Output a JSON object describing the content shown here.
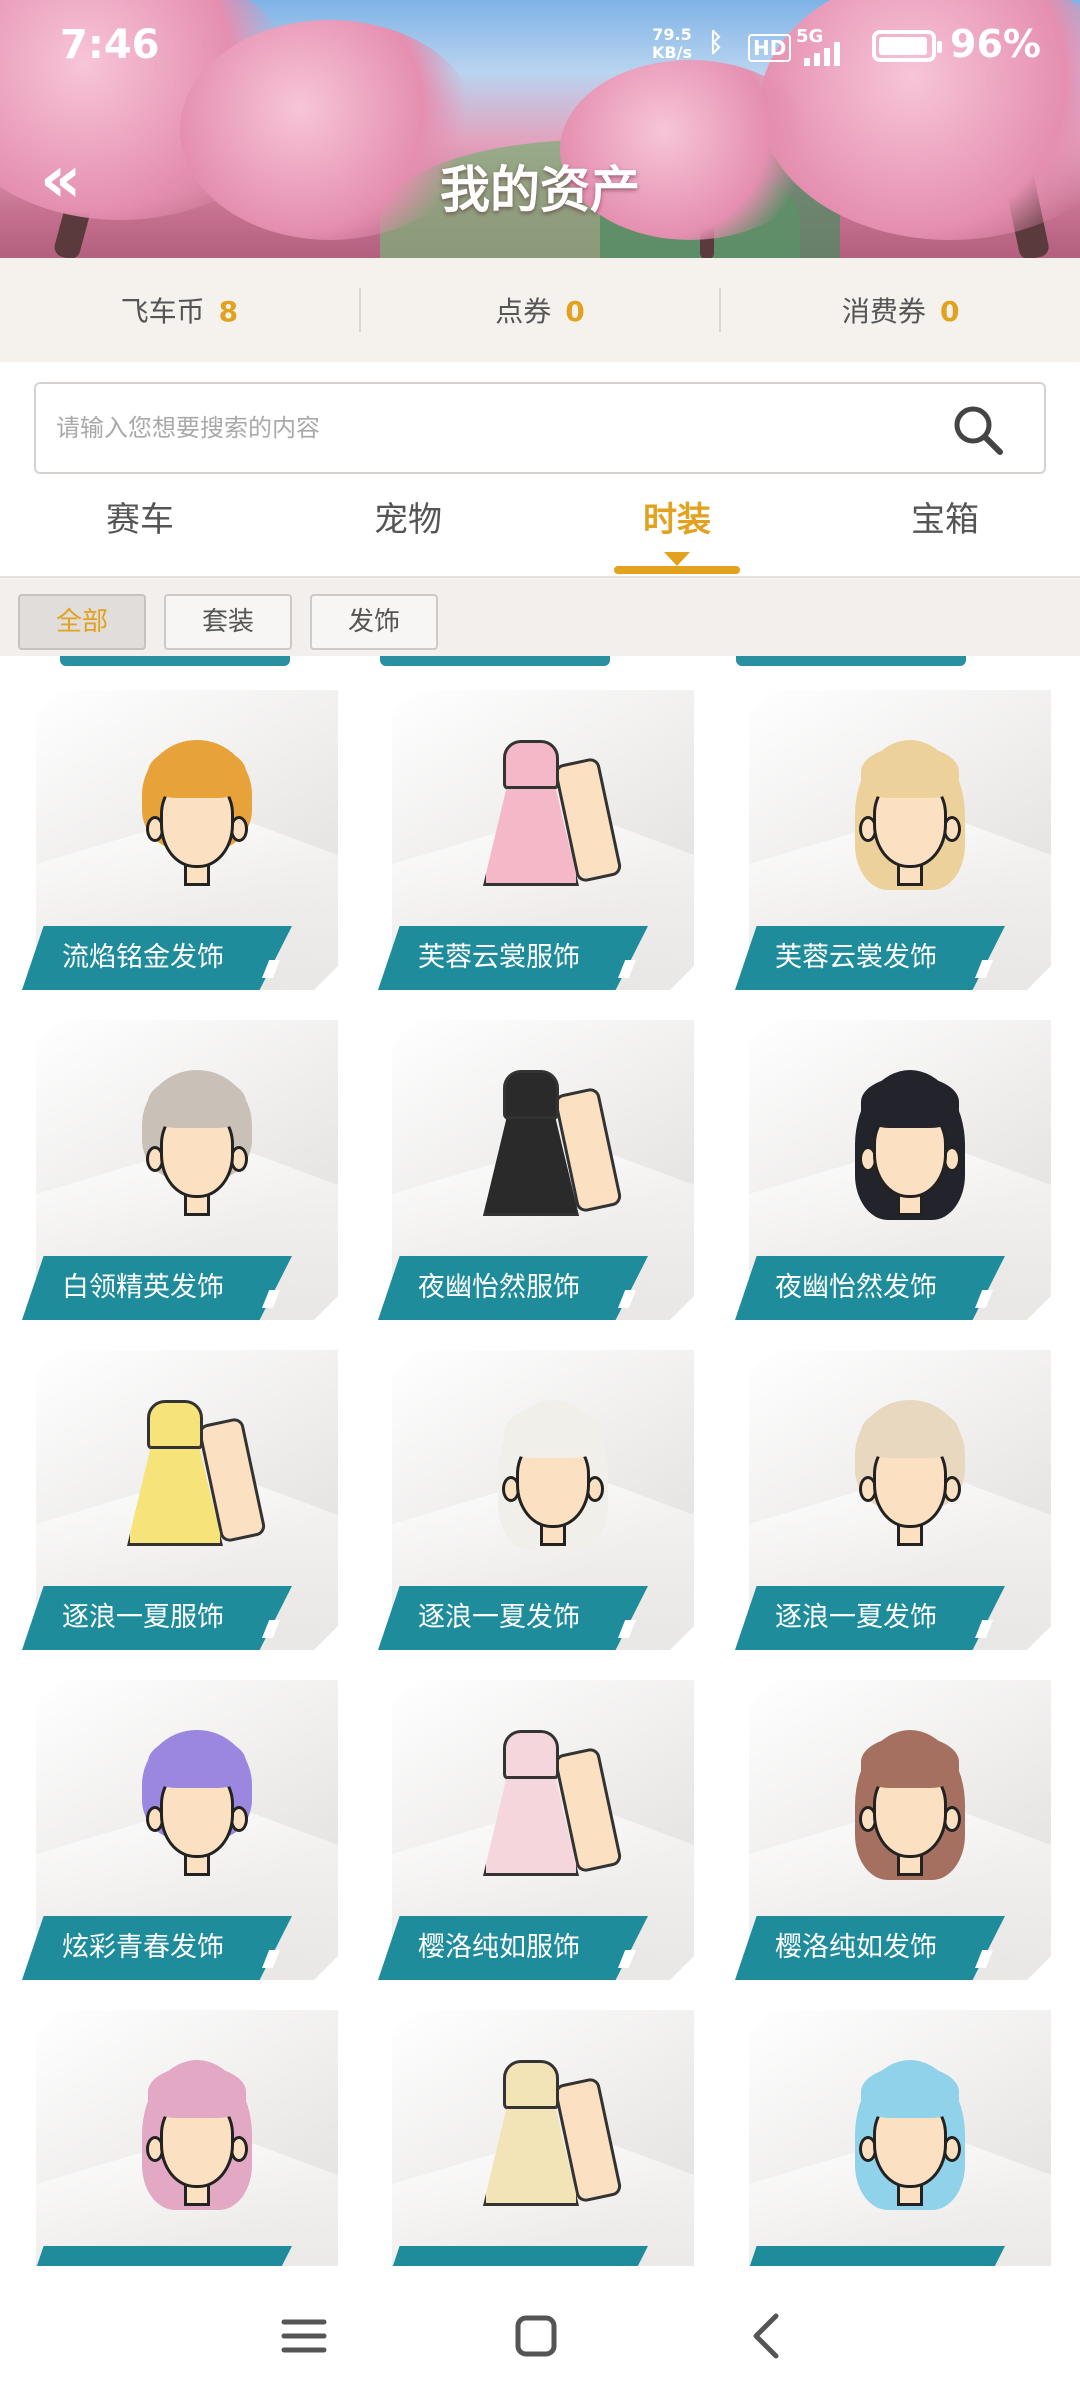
{
  "status_bar": {
    "time": "7:46",
    "net_speed_value": "79.5",
    "net_speed_unit": "KB/s",
    "hd": "HD",
    "signal": "5G",
    "battery_pct": 96,
    "battery_text": "96%"
  },
  "header": {
    "title": "我的资产",
    "back_icon": "double-chevron-left-icon"
  },
  "currency": [
    {
      "label": "飞车币",
      "value": "8"
    },
    {
      "label": "点券",
      "value": "0"
    },
    {
      "label": "消费券",
      "value": "0"
    }
  ],
  "search": {
    "placeholder": "请输入您想要搜索的内容",
    "icon": "search-icon"
  },
  "tabs": [
    {
      "label": "赛车",
      "active": false
    },
    {
      "label": "宠物",
      "active": false
    },
    {
      "label": "时装",
      "active": true
    },
    {
      "label": "宝箱",
      "active": false
    }
  ],
  "filters": [
    {
      "label": "全部",
      "active": true
    },
    {
      "label": "套装",
      "active": false
    },
    {
      "label": "发饰",
      "active": false
    }
  ],
  "items": [
    {
      "name": "流焰铭金发饰",
      "kind": "hair",
      "hair_color": "#e8a23a"
    },
    {
      "name": "芙蓉云裳服饰",
      "kind": "dress",
      "hair_color": "#f4b8c8"
    },
    {
      "name": "芙蓉云裳发饰",
      "kind": "hair-long",
      "hair_color": "#ecd19a"
    },
    {
      "name": "白领精英发饰",
      "kind": "hair",
      "hair_color": "#c9c1b8"
    },
    {
      "name": "夜幽怡然服饰",
      "kind": "dress",
      "hair_color": "#2a2a2a"
    },
    {
      "name": "夜幽怡然发饰",
      "kind": "hair-long",
      "hair_color": "#23232b"
    },
    {
      "name": "逐浪一夏服饰",
      "kind": "dress",
      "hair_color": "#f6e37a"
    },
    {
      "name": "逐浪一夏发饰",
      "kind": "hair-long",
      "hair_color": "#f1efe9"
    },
    {
      "name": "逐浪一夏发饰",
      "kind": "hair",
      "hair_color": "#e9d8c0"
    },
    {
      "name": "炫彩青春发饰",
      "kind": "hair",
      "hair_color": "#9b86e0"
    },
    {
      "name": "樱洛纯如服饰",
      "kind": "dress",
      "hair_color": "#f5d6dc"
    },
    {
      "name": "樱洛纯如发饰",
      "kind": "hair-long",
      "hair_color": "#a5705f"
    },
    {
      "name": "",
      "kind": "hair-long",
      "hair_color": "#e3a8c4"
    },
    {
      "name": "",
      "kind": "dress",
      "hair_color": "#f2e4b6"
    },
    {
      "name": "",
      "kind": "hair-long",
      "hair_color": "#8fd2ea"
    }
  ],
  "nav": [
    {
      "icon": "menu-icon"
    },
    {
      "icon": "home-square-icon"
    },
    {
      "icon": "back-chevron-icon"
    }
  ],
  "colors": {
    "accent": "#e2a11f",
    "label_bg": "#1f8c9c"
  }
}
